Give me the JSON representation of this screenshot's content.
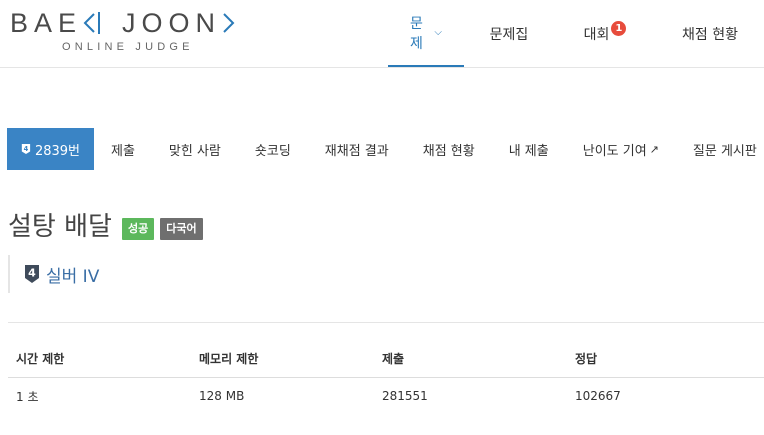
{
  "logo": {
    "main_left": "BAE",
    "main_right": "JOON",
    "sub": "ONLINE JUDGE"
  },
  "top_nav": [
    {
      "label": "문제",
      "active": true,
      "has_caret": true
    },
    {
      "label": "문제집"
    },
    {
      "label": "대회",
      "badge": "1"
    },
    {
      "label": "채점 현황"
    }
  ],
  "problem_menu": [
    {
      "label": "2839번",
      "active": true,
      "tier": "4"
    },
    {
      "label": "제출"
    },
    {
      "label": "맞힌 사람"
    },
    {
      "label": "숏코딩"
    },
    {
      "label": "재채점 결과"
    },
    {
      "label": "채점 현황"
    },
    {
      "label": "내 제출"
    },
    {
      "label": "난이도 기여",
      "external": true
    },
    {
      "label": "질문 게시판"
    }
  ],
  "problem": {
    "title": "설탕 배달",
    "labels": [
      "성공",
      "다국어"
    ],
    "tier_number": "4",
    "tier_text": "실버 IV"
  },
  "table": {
    "headers": [
      "시간 제한",
      "메모리 제한",
      "제출",
      "정답"
    ],
    "row": [
      "1 초",
      "128 MB",
      "281551",
      "102667"
    ]
  },
  "colors": {
    "accent": "#3a84c5",
    "success": "#5cb85c",
    "multi": "#6f6f6f",
    "badge": "#e74c3c",
    "tier": "#3a6ea5"
  }
}
